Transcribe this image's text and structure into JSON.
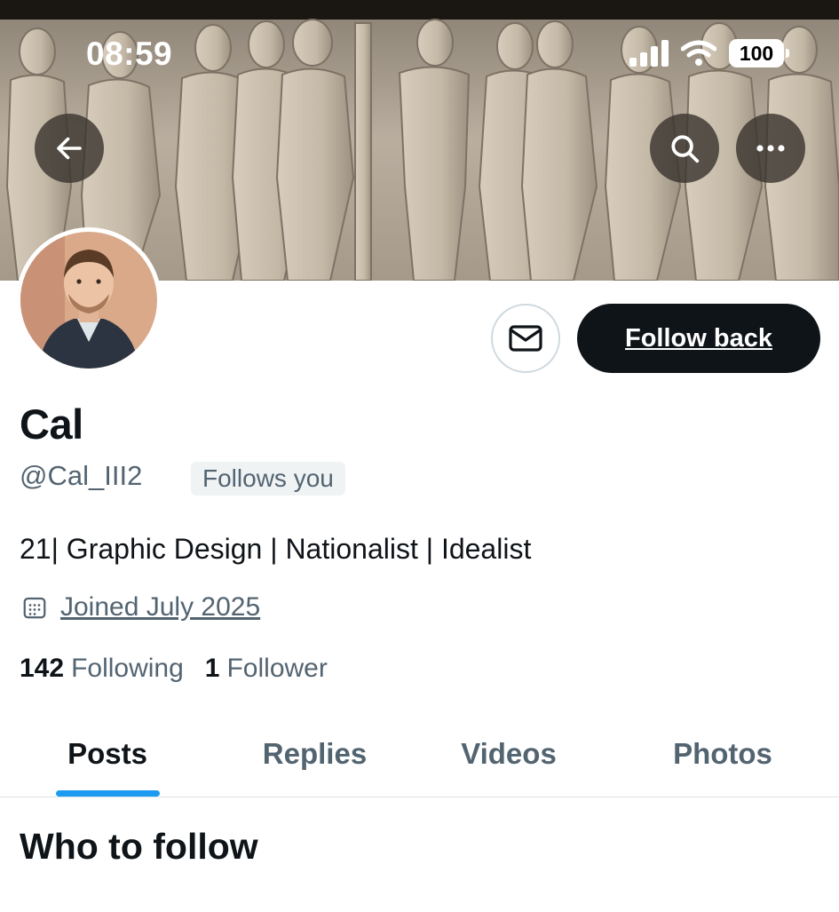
{
  "status_bar": {
    "time": "08:59",
    "battery": "100"
  },
  "header": {
    "back_icon": "arrow-left-icon",
    "search_icon": "search-icon",
    "more_icon": "more-horizontal-icon"
  },
  "profile": {
    "display_name": "Cal",
    "handle": "@Cal_III2",
    "follows_you_label": "Follows you",
    "bio": "21| Graphic Design | Nationalist | Idealist",
    "joined": "Joined July 2025",
    "following_count": "142",
    "following_label": "Following",
    "followers_count": "1",
    "followers_label": "Follower"
  },
  "actions": {
    "message_icon": "envelope-icon",
    "follow_back_label": "Follow back"
  },
  "tabs": [
    {
      "label": "Posts",
      "active": true
    },
    {
      "label": "Replies",
      "active": false
    },
    {
      "label": "Videos",
      "active": false
    },
    {
      "label": "Photos",
      "active": false
    }
  ],
  "section": {
    "who_to_follow": "Who to follow"
  },
  "colors": {
    "accent": "#1d9bf0",
    "primary_text": "#0f1419",
    "secondary_text": "#536471",
    "follow_button_bg": "#0f1419"
  }
}
